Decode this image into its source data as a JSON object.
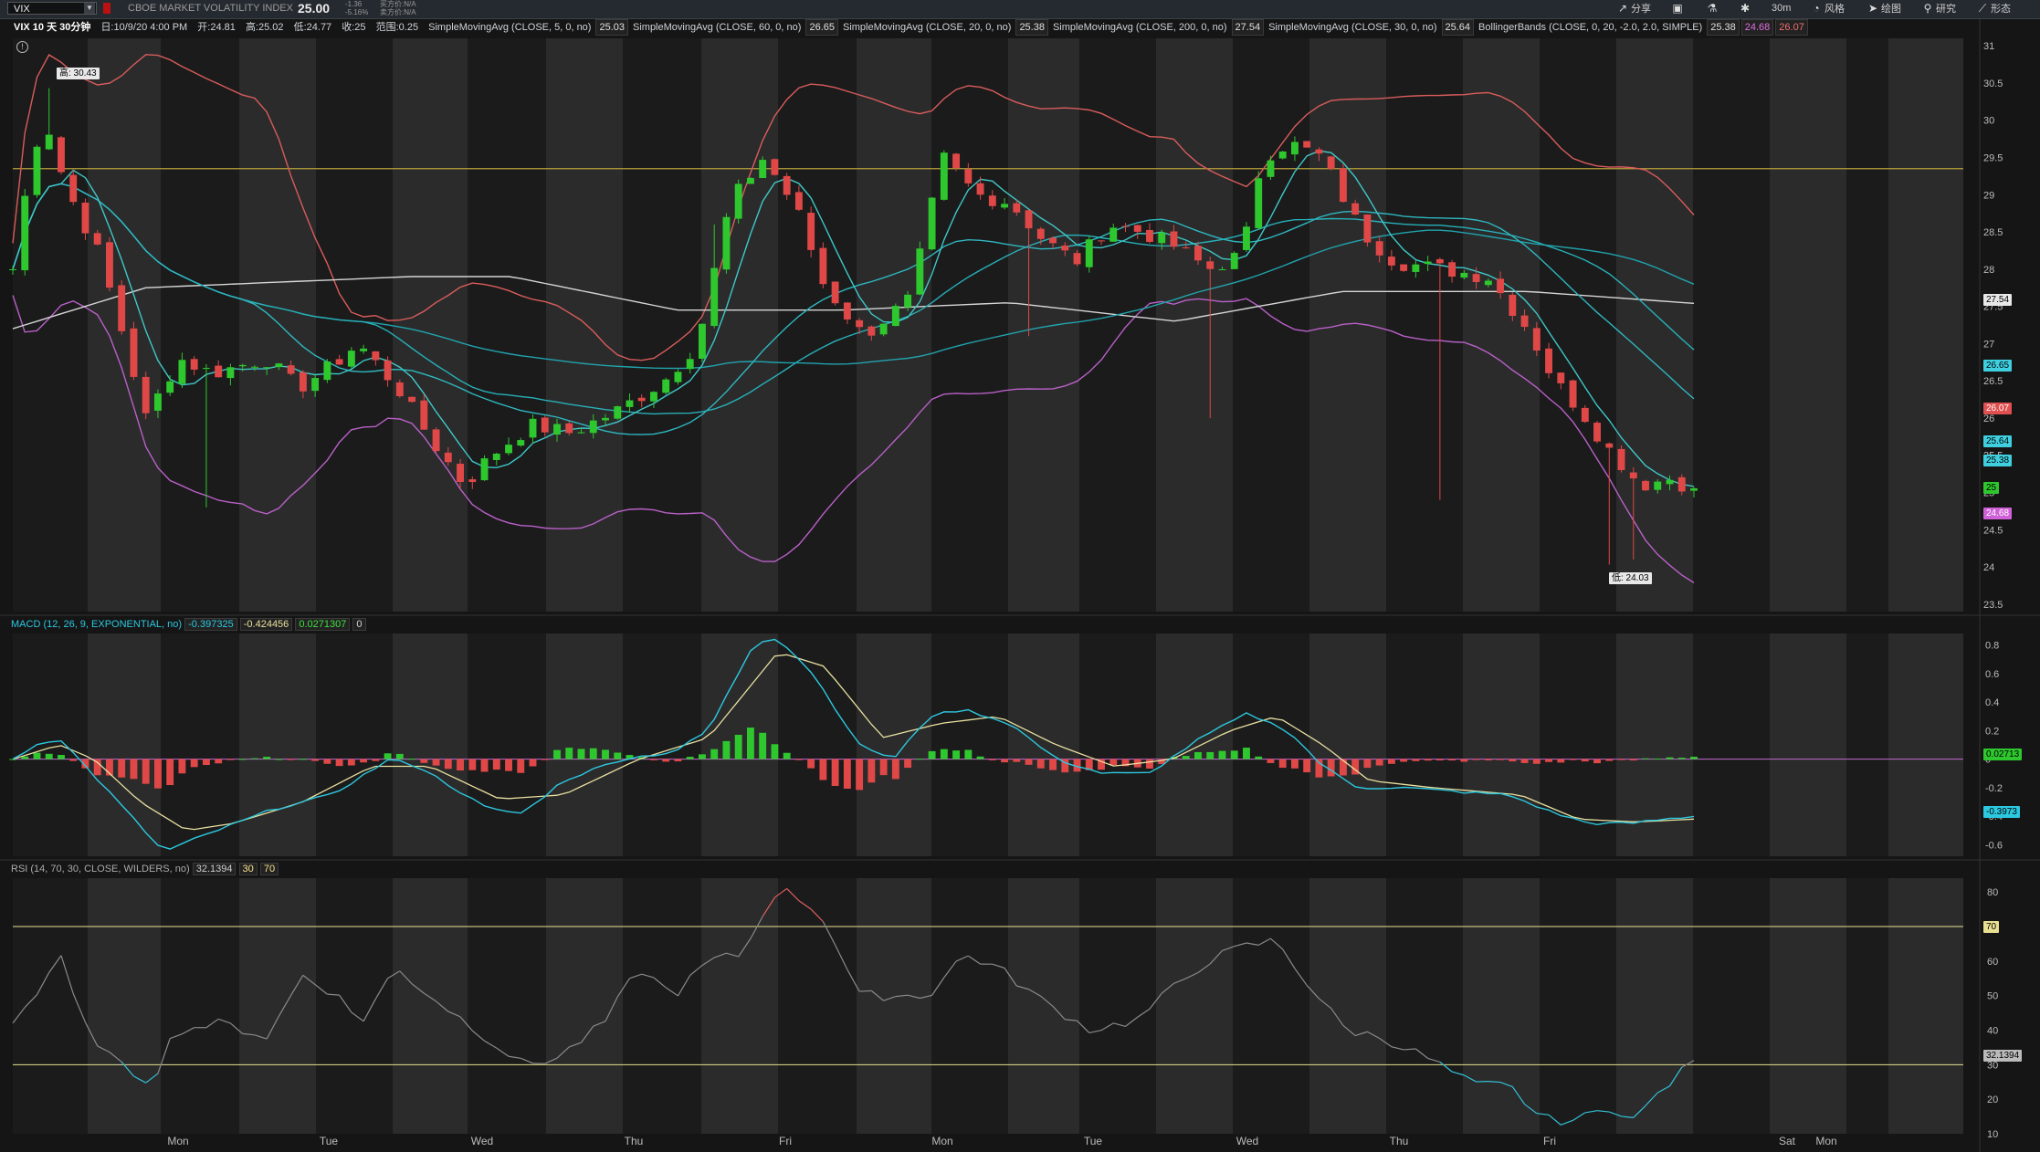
{
  "toolbar": {
    "symbol": "VIX",
    "description": "CBOE MARKET VOLATILITY INDEX",
    "last": "25.00",
    "change": "-1.36",
    "change_pct": "-5.16%",
    "bid": "买方价:N/A",
    "ask": "卖方价:N/A",
    "share_label": "分享",
    "style_label": "风格",
    "draw_label": "绘图",
    "research_label": "研究",
    "patterns_label": "形态",
    "interval_label": "30m"
  },
  "header": {
    "period": "VIX 10 天 30分钟",
    "datetime": "日:10/9/20 4:00 PM",
    "open": "开:24.81",
    "high": "高:25.02",
    "low": "低:24.77",
    "close": "收:25",
    "range": "范围:0.25",
    "studies": [
      {
        "label": "SimpleMovingAvg (CLOSE, 5, 0, no)",
        "values": [
          "25.03"
        ],
        "colors": [
          "#e0e0e0"
        ]
      },
      {
        "label": "SimpleMovingAvg (CLOSE, 60, 0, no)",
        "values": [
          "26.65"
        ],
        "colors": [
          "#e0e0e0"
        ]
      },
      {
        "label": "SimpleMovingAvg (CLOSE, 20, 0, no)",
        "values": [
          "25.38"
        ],
        "colors": [
          "#e0e0e0"
        ]
      },
      {
        "label": "SimpleMovingAvg (CLOSE, 200, 0, no)",
        "values": [
          "27.54"
        ],
        "colors": [
          "#e0e0e0"
        ]
      },
      {
        "label": "SimpleMovingAvg (CLOSE, 30, 0, no)",
        "values": [
          "25.64"
        ],
        "colors": [
          "#e0e0e0"
        ]
      },
      {
        "label": "BollingerBands (CLOSE, 0, 20, -2.0, 2.0, SIMPLE)",
        "values": [
          "25.38",
          "24.68",
          "26.07"
        ],
        "colors": [
          "#e0e0e0",
          "#e070e0",
          "#f07070"
        ]
      }
    ]
  },
  "colors": {
    "background": "#151515",
    "shade": "#2b2b2b",
    "dark": "#1b1b1b",
    "up": "#2ec82e",
    "down": "#e04848",
    "sma5": "#3fc7c7",
    "sma20": "#2fb7c0",
    "sma30": "#27b0b8",
    "sma60": "#21a3ad",
    "sma200": "#d6d6d6",
    "bb_upper": "#d95c5c",
    "bb_lower": "#b960c8",
    "hline": "#b9a33a",
    "macd": "#2cc8e0",
    "signal": "#e8e0a0",
    "rsi": "#8a8a8a",
    "rsi_os": "#33c3d8",
    "rsi_ob": "#e06060"
  },
  "macd_header": {
    "label": "MACD (12, 26, 9, EXPONENTIAL, no)",
    "value": "-0.397325",
    "avg": "-0.424456",
    "diff": "0.0271307",
    "zero": "0"
  },
  "rsi_header": {
    "label": "RSI (14, 70, 30, CLOSE, WILDERS, no)",
    "value": "32.1394",
    "ob": "30",
    "os": "70"
  },
  "price_tags": {
    "high_marker": "高: 30.43",
    "low_marker": "低: 24.03",
    "sma200": "27.54",
    "sma60": "26.65",
    "bb_upper": "26.07",
    "sma30": "25.64",
    "sma20": "25.38",
    "last": "25",
    "bb_lower": "24.68",
    "macd_diff": "0.02713",
    "macd_val": "-0.3973",
    "rsi_val": "32.1394",
    "rsi_70": "70"
  },
  "chart_data": [
    {
      "type": "candlestick",
      "title": "VIX 10 天 30分钟",
      "x_ticks": [
        "Mon",
        "Tue",
        "Wed",
        "Thu",
        "Fri",
        "Mon",
        "Tue",
        "Wed",
        "Thu",
        "Fri",
        "Sat",
        "Mon"
      ],
      "y_ticks": [
        "31",
        "30.5",
        "30",
        "29.5",
        "29",
        "28.5",
        "28",
        "27.5",
        "27",
        "26.5",
        "26",
        "25.5",
        "25",
        "24.5",
        "24",
        "23.5"
      ],
      "ylim": [
        23.4,
        31.1
      ],
      "reference_line": 29.35,
      "bars_per_day": 14,
      "days": 10,
      "anchors": [
        [
          0,
          28.0
        ],
        [
          3,
          29.6
        ],
        [
          5,
          30.0
        ],
        [
          8,
          29.1
        ],
        [
          13,
          28.2
        ],
        [
          17,
          27.0
        ],
        [
          20,
          26.0
        ],
        [
          25,
          26.8
        ],
        [
          30,
          26.6
        ],
        [
          38,
          26.8
        ],
        [
          43,
          26.4
        ],
        [
          48,
          26.7
        ],
        [
          52,
          27.0
        ],
        [
          58,
          26.4
        ],
        [
          63,
          25.7
        ],
        [
          68,
          25.1
        ],
        [
          72,
          25.5
        ],
        [
          78,
          25.9
        ],
        [
          84,
          25.8
        ],
        [
          91,
          26.1
        ],
        [
          98,
          26.5
        ],
        [
          103,
          27.0
        ],
        [
          108,
          28.9
        ],
        [
          113,
          29.5
        ],
        [
          118,
          28.8
        ],
        [
          122,
          27.8
        ],
        [
          128,
          27.1
        ],
        [
          135,
          27.6
        ],
        [
          140,
          29.5
        ],
        [
          145,
          29.0
        ],
        [
          150,
          28.9
        ],
        [
          155,
          28.4
        ],
        [
          160,
          28.1
        ],
        [
          165,
          28.6
        ],
        [
          170,
          28.5
        ],
        [
          175,
          28.3
        ],
        [
          180,
          28.0
        ],
        [
          185,
          28.2
        ],
        [
          188,
          29.5
        ],
        [
          192,
          29.7
        ],
        [
          197,
          29.5
        ],
        [
          203,
          28.5
        ],
        [
          208,
          28.1
        ],
        [
          215,
          28.0
        ],
        [
          222,
          27.9
        ],
        [
          228,
          27.2
        ],
        [
          232,
          26.5
        ],
        [
          236,
          26.1
        ],
        [
          240,
          25.6
        ],
        [
          245,
          25.1
        ],
        [
          250,
          25.2
        ],
        [
          253,
          25.0
        ]
      ],
      "wicks": {
        "spike_low": [
          [
            30,
            24.8
          ],
          [
            152,
            27.1
          ],
          [
            180,
            26.0
          ],
          [
            214,
            24.9
          ],
          [
            241,
            24.03
          ],
          [
            243,
            24.1
          ]
        ],
        "spike_high": [
          [
            6,
            30.43
          ],
          [
            106,
            28.6
          ]
        ]
      },
      "series": [
        {
          "name": "SimpleMovingAvg (CLOSE, 5, 0, no)",
          "period": 5,
          "last": 25.03
        },
        {
          "name": "SimpleMovingAvg (CLOSE, 20, 0, no)",
          "period": 20,
          "last": 25.38
        },
        {
          "name": "SimpleMovingAvg (CLOSE, 30, 0, no)",
          "period": 30,
          "last": 25.64
        },
        {
          "name": "SimpleMovingAvg (CLOSE, 60, 0, no)",
          "period": 60,
          "last": 26.65
        },
        {
          "name": "SimpleMovingAvg (CLOSE, 200, 0, no)",
          "period": 200,
          "values_points": [
            [
              0,
              27.2
            ],
            [
              20,
              27.75
            ],
            [
              60,
              27.9
            ],
            [
              75,
              27.9
            ],
            [
              100,
              27.45
            ],
            [
              125,
              27.45
            ],
            [
              150,
              27.55
            ],
            [
              175,
              27.3
            ],
            [
              200,
              27.7
            ],
            [
              228,
              27.7
            ],
            [
              253,
              27.54
            ]
          ]
        },
        {
          "name": "BollingerBands upper",
          "last": 26.07
        },
        {
          "name": "BollingerBands lower",
          "last": 24.68
        }
      ]
    },
    {
      "type": "macd",
      "title": "MACD (12, 26, 9, EXPONENTIAL, no)",
      "y_ticks": [
        "0.8",
        "0.6",
        "0.4",
        "0.2",
        "0",
        "-0.2",
        "-0.4",
        "-0.6"
      ],
      "ylim": [
        -0.68,
        0.88
      ],
      "macd_anchors": [
        [
          0,
          0.0
        ],
        [
          4,
          0.1
        ],
        [
          8,
          0.15
        ],
        [
          20,
          -0.38
        ],
        [
          26,
          -0.65
        ],
        [
          32,
          -0.55
        ],
        [
          45,
          -0.35
        ],
        [
          55,
          -0.25
        ],
        [
          65,
          0.0
        ],
        [
          70,
          -0.05
        ],
        [
          82,
          -0.35
        ],
        [
          88,
          -0.38
        ],
        [
          95,
          -0.15
        ],
        [
          105,
          0.0
        ],
        [
          114,
          0.05
        ],
        [
          120,
          0.2
        ],
        [
          128,
          0.82
        ],
        [
          132,
          0.85
        ],
        [
          138,
          0.6
        ],
        [
          146,
          0.1
        ],
        [
          152,
          0.0
        ],
        [
          158,
          0.3
        ],
        [
          164,
          0.35
        ],
        [
          172,
          0.25
        ],
        [
          180,
          0.0
        ],
        [
          188,
          -0.1
        ],
        [
          196,
          -0.1
        ],
        [
          205,
          0.15
        ],
        [
          213,
          0.32
        ],
        [
          220,
          0.2
        ],
        [
          226,
          -0.05
        ],
        [
          232,
          -0.2
        ],
        [
          240,
          -0.2
        ],
        [
          250,
          -0.23
        ],
        [
          258,
          -0.25
        ],
        [
          266,
          -0.38
        ],
        [
          272,
          -0.45
        ],
        [
          279,
          -0.45
        ],
        [
          285,
          -0.42
        ],
        [
          290,
          -0.4
        ]
      ],
      "signal_anchors": [
        [
          0,
          0.0
        ],
        [
          8,
          0.1
        ],
        [
          14,
          0.0
        ],
        [
          22,
          -0.3
        ],
        [
          30,
          -0.5
        ],
        [
          38,
          -0.45
        ],
        [
          50,
          -0.3
        ],
        [
          62,
          -0.05
        ],
        [
          72,
          -0.05
        ],
        [
          84,
          -0.28
        ],
        [
          95,
          -0.25
        ],
        [
          108,
          0.0
        ],
        [
          120,
          0.15
        ],
        [
          132,
          0.75
        ],
        [
          140,
          0.65
        ],
        [
          150,
          0.15
        ],
        [
          160,
          0.25
        ],
        [
          170,
          0.3
        ],
        [
          180,
          0.1
        ],
        [
          190,
          -0.05
        ],
        [
          200,
          0.0
        ],
        [
          210,
          0.2
        ],
        [
          218,
          0.3
        ],
        [
          226,
          0.1
        ],
        [
          234,
          -0.15
        ],
        [
          245,
          -0.2
        ],
        [
          260,
          -0.25
        ],
        [
          270,
          -0.42
        ],
        [
          280,
          -0.44
        ],
        [
          290,
          -0.42
        ]
      ],
      "last": {
        "macd": -0.397325,
        "avg": -0.424456,
        "diff": 0.0271307
      }
    },
    {
      "type": "line",
      "title": "RSI (14, 70, 30, CLOSE, WILDERS, no)",
      "y_ticks": [
        "80",
        "70",
        "60",
        "50",
        "40",
        "30",
        "20",
        "10"
      ],
      "ylim": [
        10,
        84
      ],
      "levels": [
        30,
        70
      ],
      "anchors": [
        [
          0,
          43
        ],
        [
          4,
          50
        ],
        [
          8,
          62
        ],
        [
          12,
          42
        ],
        [
          18,
          30
        ],
        [
          24,
          25
        ],
        [
          28,
          40
        ],
        [
          36,
          42
        ],
        [
          44,
          38
        ],
        [
          50,
          56
        ],
        [
          56,
          50
        ],
        [
          60,
          42
        ],
        [
          66,
          58
        ],
        [
          72,
          50
        ],
        [
          80,
          40
        ],
        [
          88,
          30
        ],
        [
          94,
          32
        ],
        [
          102,
          42
        ],
        [
          108,
          58
        ],
        [
          114,
          50
        ],
        [
          120,
          60
        ],
        [
          126,
          62
        ],
        [
          130,
          76
        ],
        [
          132,
          81
        ],
        [
          136,
          78
        ],
        [
          140,
          72
        ],
        [
          146,
          50
        ],
        [
          152,
          50
        ],
        [
          158,
          50
        ],
        [
          164,
          62
        ],
        [
          170,
          58
        ],
        [
          178,
          48
        ],
        [
          186,
          40
        ],
        [
          194,
          43
        ],
        [
          200,
          52
        ],
        [
          206,
          60
        ],
        [
          212,
          64
        ],
        [
          218,
          66
        ],
        [
          224,
          52
        ],
        [
          230,
          40
        ],
        [
          236,
          38
        ],
        [
          244,
          32
        ],
        [
          252,
          24
        ],
        [
          258,
          24
        ],
        [
          264,
          14
        ],
        [
          270,
          14
        ],
        [
          276,
          18
        ],
        [
          280,
          14
        ],
        [
          284,
          22
        ],
        [
          288,
          28
        ],
        [
          290,
          32
        ]
      ],
      "last": 32.1394
    }
  ]
}
